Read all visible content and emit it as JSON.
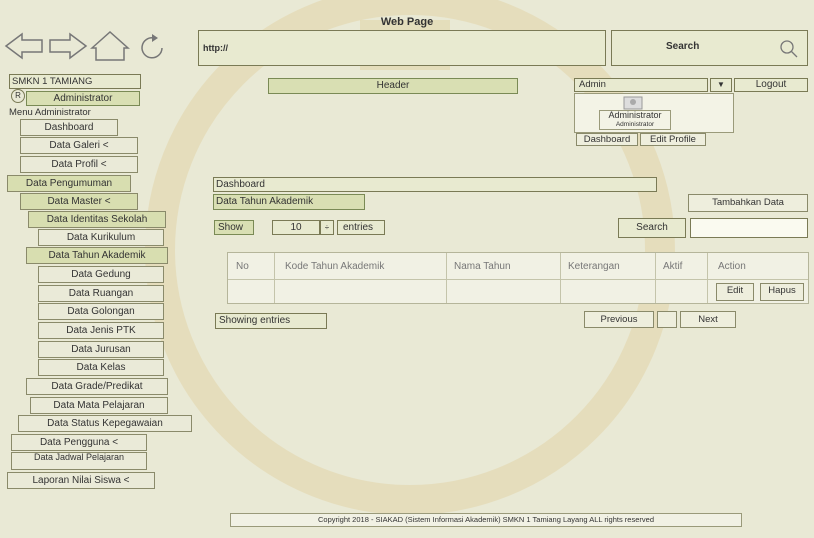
{
  "browser": {
    "title": "Web Page",
    "url": "http://",
    "search_label": "Search"
  },
  "sidebar": {
    "school": "SMKN 1 TAMIANG",
    "role": "Administrator",
    "menu_title": "Menu Administrator",
    "items": [
      "Dashboard",
      "Data Galeri <",
      "Data Profil <",
      "Data Pengumuman",
      "Data Master <",
      "Data Identitas Sekolah",
      "Data Kurikulum",
      "Data Tahun Akademik",
      "Data Gedung",
      "Data Ruangan",
      "Data Golongan",
      "Data Jenis PTK",
      "Data Jurusan",
      "Data Kelas",
      "Data Grade/Predikat",
      "Data Mata Pelajaran",
      "Data Status Kepegawaian",
      "Data Pengguna <",
      "Data Jadwal Pelajaran",
      "Laporan Nilai Siswa <"
    ]
  },
  "header": {
    "label": "Header",
    "admin_select": "Admin",
    "logout": "Logout",
    "profile_name": "Administrator",
    "profile_role": "Administrator",
    "dashboard_btn": "Dashboard",
    "edit_profile_btn": "Edit Profile"
  },
  "main": {
    "breadcrumb": "Dashboard",
    "page_title": "Data Tahun Akademik",
    "add_button": "Tambahkan Data",
    "show_label": "Show",
    "entries_value": "10",
    "entries_label": "entries",
    "search_label": "Search",
    "columns": [
      "No",
      "Kode Tahun Akademik",
      "Nama Tahun",
      "Keterangan",
      "Aktif",
      "Action"
    ],
    "edit_button": "Edit",
    "delete_button": "Hapus",
    "showing_entries": "Showing entries",
    "previous": "Previous",
    "next": "Next"
  },
  "footer": {
    "text": "Copyright 2018 - SIAKAD (Sistem Informasi Akademik) SMKN 1 Tamiang Layang ALL rights reserved"
  },
  "colors": {
    "background": "#e9e9d5",
    "accent": "#d8deb0"
  }
}
